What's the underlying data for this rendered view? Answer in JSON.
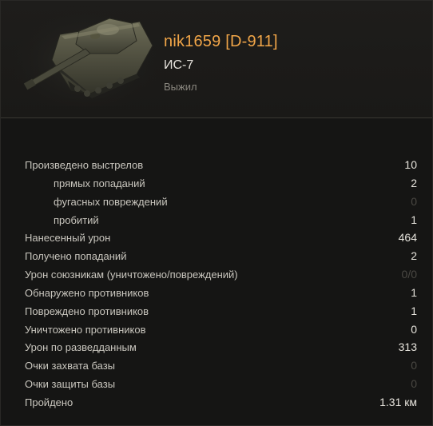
{
  "header": {
    "player_name": "nik1659 [D-911]",
    "tank_name": "ИС-7",
    "status": "Выжил"
  },
  "stats": [
    {
      "label": "Произведено выстрелов",
      "value": "10",
      "sub": false,
      "dim": false
    },
    {
      "label": "прямых попаданий",
      "value": "2",
      "sub": true,
      "dim": false
    },
    {
      "label": "фугасных повреждений",
      "value": "0",
      "sub": true,
      "dim": true
    },
    {
      "label": "пробитий",
      "value": "1",
      "sub": true,
      "dim": false
    },
    {
      "label": "Нанесенный урон",
      "value": "464",
      "sub": false,
      "dim": false
    },
    {
      "label": "Получено попаданий",
      "value": "2",
      "sub": false,
      "dim": false
    },
    {
      "label": "Урон союзникам (уничтожено/повреждений)",
      "value": "0/0",
      "sub": false,
      "dim": true
    },
    {
      "label": "Обнаружено противников",
      "value": "1",
      "sub": false,
      "dim": false
    },
    {
      "label": "Повреждено противников",
      "value": "1",
      "sub": false,
      "dim": false
    },
    {
      "label": "Уничтожено противников",
      "value": "0",
      "sub": false,
      "dim": false
    },
    {
      "label": "Урон по разведданным",
      "value": "313",
      "sub": false,
      "dim": false
    },
    {
      "label": "Очки захвата базы",
      "value": "0",
      "sub": false,
      "dim": true
    },
    {
      "label": "Очки защиты базы",
      "value": "0",
      "sub": false,
      "dim": true
    },
    {
      "label": "Пройдено",
      "value": "1.31  км",
      "sub": false,
      "dim": false
    }
  ],
  "colors": {
    "player_name": "#f0a548",
    "text": "#c9c6be",
    "dim_value": "#4a4843",
    "background": "#151514"
  },
  "icons": {
    "tank": "tank-is7-image"
  }
}
